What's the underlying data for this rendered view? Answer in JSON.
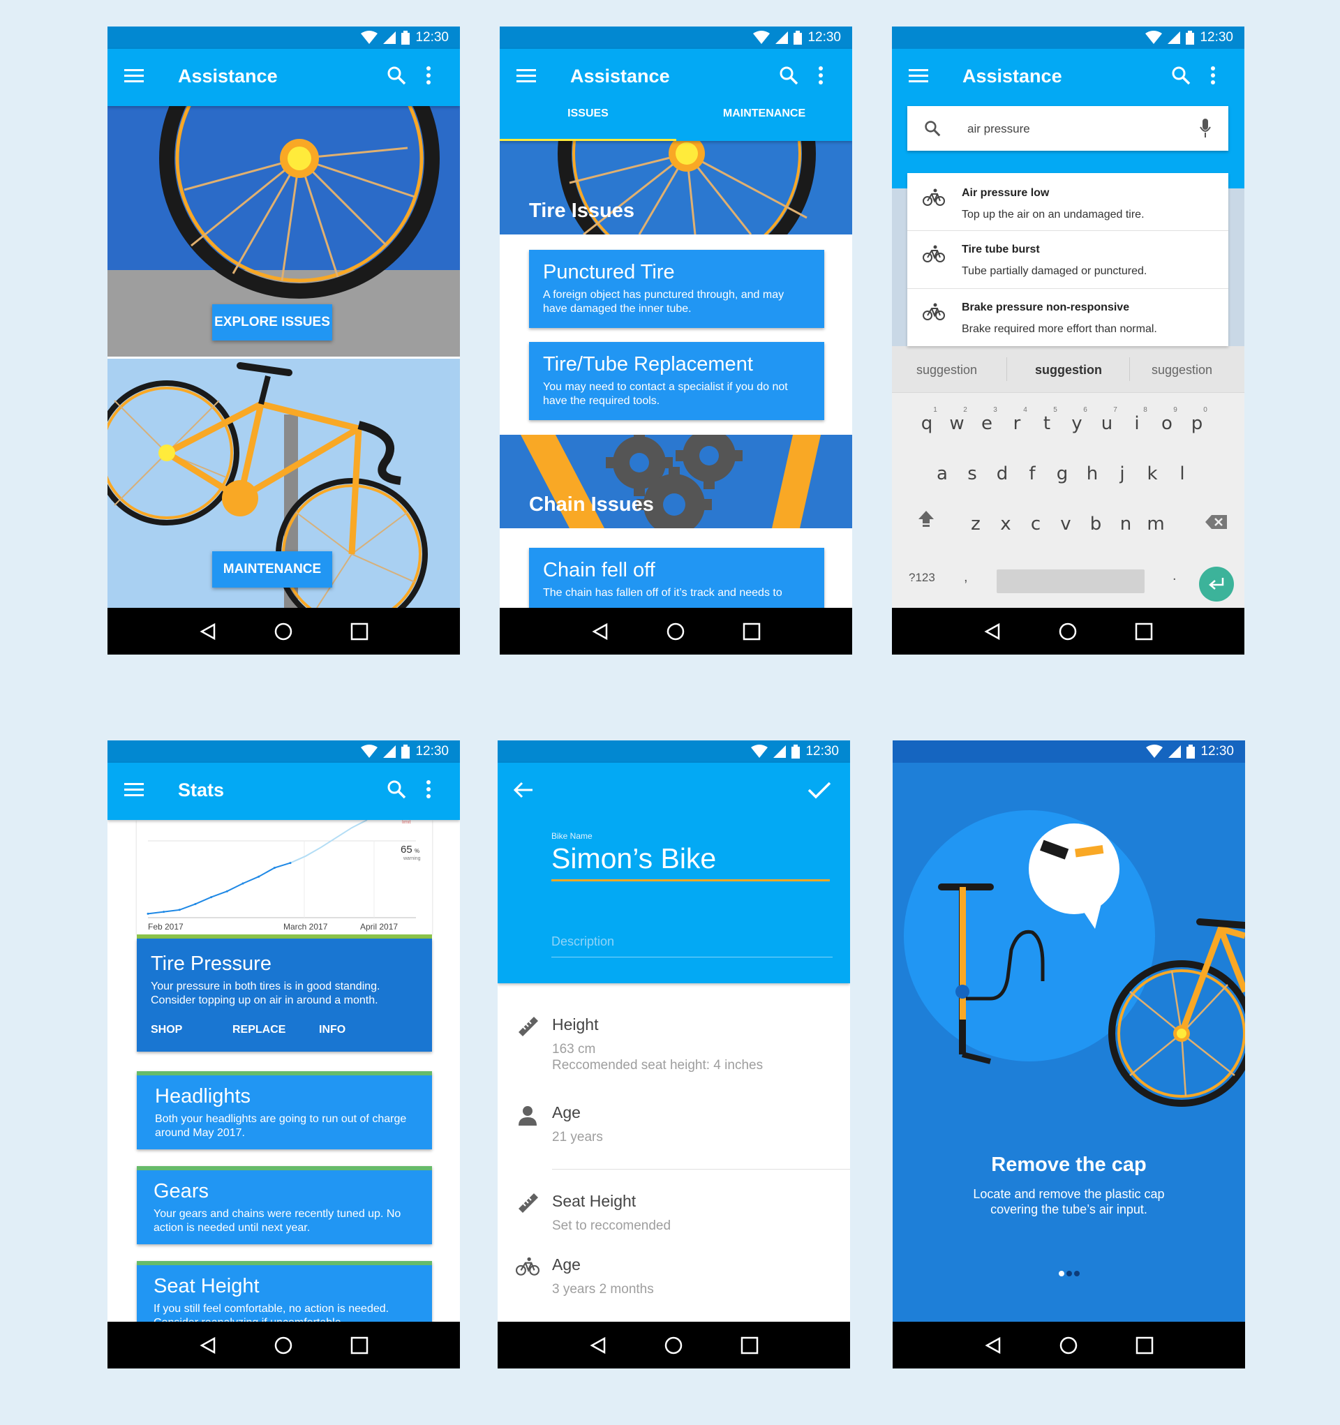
{
  "status": {
    "time": "12:30"
  },
  "screen1": {
    "title": "Assistance",
    "explore_label": "EXPLORE ISSUES",
    "maintenance_label": "MAINTENANCE"
  },
  "screen2": {
    "title": "Assistance",
    "tabs": [
      "ISSUES",
      "MAINTENANCE"
    ],
    "tire_header": "Tire Issues",
    "chain_header": "Chain Issues",
    "cards": [
      {
        "title": "Punctured Tire",
        "desc": "A foreign object has punctured through, and may have damaged the inner tube."
      },
      {
        "title": "Tire/Tube Replacement",
        "desc": "You may need to contact a specialist if you do not have the required tools."
      },
      {
        "title": "Chain fell off",
        "desc": "The chain has fallen off of it’s track and needs to"
      }
    ]
  },
  "screen3": {
    "title": "Assistance",
    "search_value": "air pressure",
    "results": [
      {
        "title": "Air pressure low",
        "desc": "Top up the air on an undamaged tire."
      },
      {
        "title": "Tire tube burst",
        "desc": "Tube partially damaged or punctured."
      },
      {
        "title": "Brake pressure non-responsive",
        "desc": "Brake required more effort than normal."
      }
    ],
    "suggestions": [
      "suggestion",
      "suggestion",
      "suggestion"
    ],
    "keys_row1": [
      "q",
      "w",
      "e",
      "r",
      "t",
      "y",
      "u",
      "i",
      "o",
      "p"
    ],
    "keys_row1_nums": [
      "1",
      "2",
      "3",
      "4",
      "5",
      "6",
      "7",
      "8",
      "9",
      "0"
    ],
    "keys_row2": [
      "a",
      "s",
      "d",
      "f",
      "g",
      "h",
      "j",
      "k",
      "l"
    ],
    "keys_row3": [
      "z",
      "x",
      "c",
      "v",
      "b",
      "n",
      "m"
    ],
    "key_symbols": "?123",
    "key_comma": ",",
    "key_period": "."
  },
  "screen4": {
    "title": "Stats",
    "chart_data": {
      "type": "line",
      "x_labels": [
        "Feb 2017",
        "March 2017",
        "April 2017"
      ],
      "annotation_value": "65",
      "annotation_unit": "%",
      "annotation_sub": "warning",
      "limit_label": "limit",
      "series": [
        {
          "values": [
            4,
            6,
            8,
            14,
            21,
            27,
            35,
            42,
            51,
            56
          ],
          "projected": [
            56,
            63,
            72,
            82,
            92,
            100
          ]
        }
      ],
      "ylim": [
        0,
        100
      ]
    },
    "cards": [
      {
        "title": "Tire Pressure",
        "desc": "Your pressure in both tires is in good standing. Consider topping up on air in around a month.",
        "actions": [
          "SHOP",
          "REPLACE",
          "INFO"
        ]
      },
      {
        "title": "Headlights",
        "desc": "Both your headlights are going to run out of charge around May 2017."
      },
      {
        "title": "Gears",
        "desc": "Your gears and chains were recently tuned up. No action is needed until next year."
      },
      {
        "title": "Seat Height",
        "desc": "If you still feel comfortable, no action is needed. Consider reanalyzing if uncomfortable."
      }
    ]
  },
  "screen5": {
    "bike_name_label": "Bike Name",
    "bike_name": "Simon’s Bike",
    "description_placeholder": "Description",
    "items": [
      {
        "title": "Height",
        "line1": "163 cm",
        "line2": "Reccomended seat height: 4 inches"
      },
      {
        "title": "Age",
        "line1": "21 years"
      },
      {
        "title": "Seat Height",
        "line1": "Set to reccomended"
      },
      {
        "title": "Age",
        "line1": "3 years 2 months"
      }
    ]
  },
  "screen6": {
    "title": "Remove the cap",
    "desc_line1": "Locate and remove the plastic cap",
    "desc_line2": "covering the tube’s air input.",
    "page_index": 1,
    "page_count": 3
  },
  "colors": {
    "primary": "#03A9F4",
    "primary_dark": "#0288D1",
    "card": "#2196F3",
    "accent_yellow": "#F9A825",
    "onboarding_bg": "#1E7FD8"
  }
}
